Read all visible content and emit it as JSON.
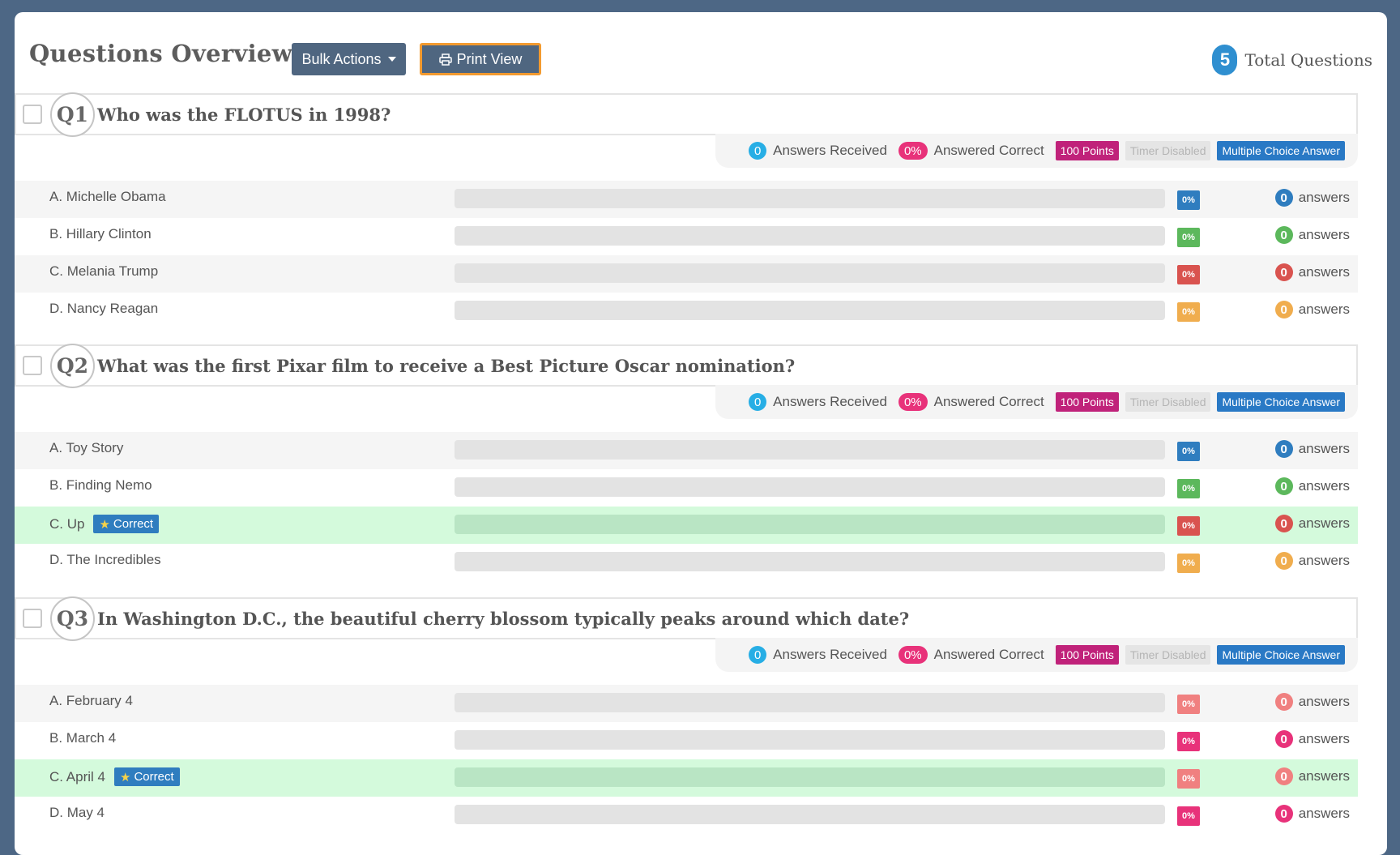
{
  "header": {
    "title": "Questions Overview",
    "bulk_actions_label": "Bulk Actions",
    "print_view_label": "Print View",
    "total_count": "5",
    "total_label": "Total Questions"
  },
  "meta_labels": {
    "answers_received": "Answers Received",
    "answered_correct": "Answered Correct",
    "answers": "answers",
    "correct_tag": "Correct"
  },
  "colors": {
    "blue": "#2f7dbf",
    "green": "#5cb85c",
    "red": "#d9534f",
    "orange": "#f0ad4e",
    "salmon": "#f08080",
    "pink": "#e8327a",
    "cyan": "#27aee5",
    "points_magenta": "#c0227a",
    "mc_blue": "#2979c5",
    "timer_gray": "#e5e5e5"
  },
  "questions": [
    {
      "number": "Q1",
      "text": "Who was the FLOTUS in 1998?",
      "answers_received": "0",
      "answered_correct": "0%",
      "points": "100 Points",
      "timer": "Timer Disabled",
      "type": "Multiple Choice Answer",
      "options": [
        {
          "label": "A. Michelle Obama",
          "percent": "0%",
          "fill": 0,
          "count": "0",
          "color": "blue",
          "correct": false
        },
        {
          "label": "B. Hillary Clinton",
          "percent": "0%",
          "fill": 0,
          "count": "0",
          "color": "green",
          "correct": false
        },
        {
          "label": "C. Melania Trump",
          "percent": "0%",
          "fill": 0,
          "count": "0",
          "color": "red",
          "correct": false
        },
        {
          "label": "D. Nancy Reagan",
          "percent": "0%",
          "fill": 0,
          "count": "0",
          "color": "orange",
          "correct": false
        }
      ]
    },
    {
      "number": "Q2",
      "text": "What was the first Pixar film to receive a Best Picture Oscar nomination?",
      "answers_received": "0",
      "answered_correct": "0%",
      "points": "100 Points",
      "timer": "Timer Disabled",
      "type": "Multiple Choice Answer",
      "options": [
        {
          "label": "A. Toy Story",
          "percent": "0%",
          "fill": 0,
          "count": "0",
          "color": "blue",
          "correct": false
        },
        {
          "label": "B. Finding Nemo",
          "percent": "0%",
          "fill": 0,
          "count": "0",
          "color": "green",
          "correct": false
        },
        {
          "label": "C. Up",
          "percent": "0%",
          "fill": 0,
          "count": "0",
          "color": "red",
          "correct": true
        },
        {
          "label": "D. The Incredibles",
          "percent": "0%",
          "fill": 0,
          "count": "0",
          "color": "orange",
          "correct": false
        }
      ]
    },
    {
      "number": "Q3",
      "text": "In Washington D.C., the beautiful cherry blossom typically peaks around which date?",
      "answers_received": "0",
      "answered_correct": "0%",
      "points": "100 Points",
      "timer": "Timer Disabled",
      "type": "Multiple Choice Answer",
      "options": [
        {
          "label": "A. February 4",
          "percent": "0%",
          "fill": 0,
          "count": "0",
          "color": "salmon",
          "correct": false
        },
        {
          "label": "B. March 4",
          "percent": "0%",
          "fill": 0,
          "count": "0",
          "color": "pink",
          "correct": false
        },
        {
          "label": "C. April 4",
          "percent": "0%",
          "fill": 0,
          "count": "0",
          "color": "salmon",
          "correct": true
        },
        {
          "label": "D. May 4",
          "percent": "0%",
          "fill": 0,
          "count": "0",
          "color": "pink",
          "correct": false
        }
      ]
    }
  ]
}
